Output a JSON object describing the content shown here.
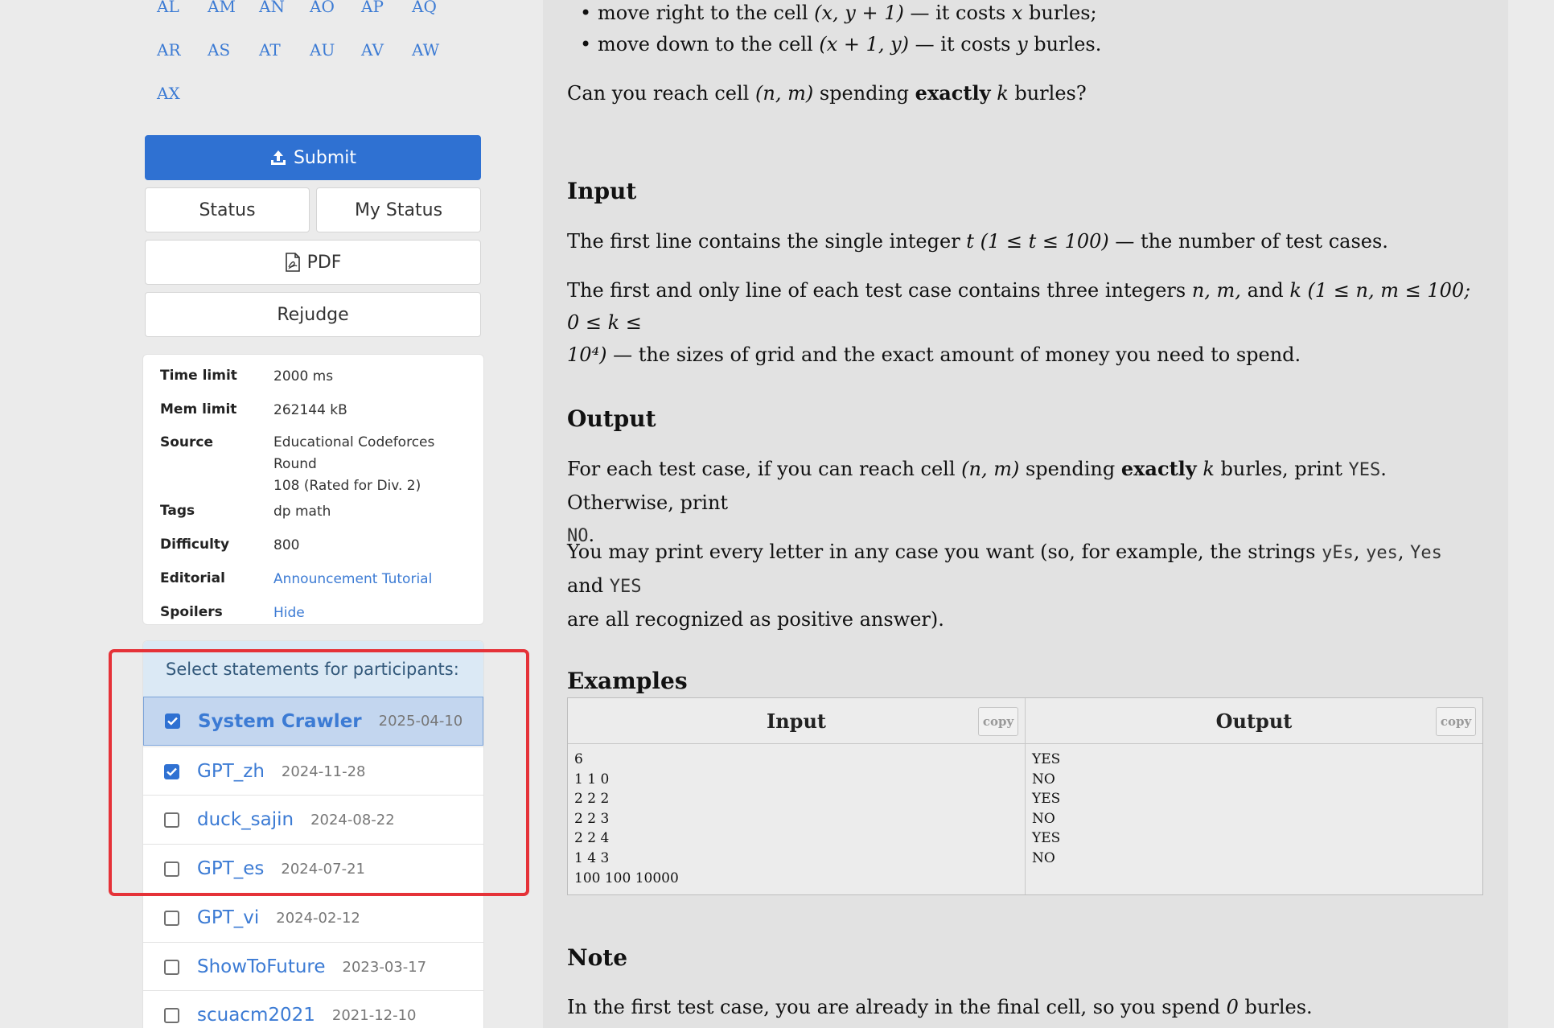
{
  "letters": [
    "AL",
    "AM",
    "AN",
    "AO",
    "AP",
    "AQ",
    "AR",
    "AS",
    "AT",
    "AU",
    "AV",
    "AW",
    "AX"
  ],
  "actions": {
    "submit": "Submit",
    "status": "Status",
    "my_status": "My Status",
    "pdf": "PDF",
    "rejudge": "Rejudge"
  },
  "info": {
    "time_limit_label": "Time limit",
    "time_limit": "2000 ms",
    "mem_limit_label": "Mem limit",
    "mem_limit": "262144 kB",
    "source_label": "Source",
    "source_line1": "Educational Codeforces Round",
    "source_line2": "108 (Rated for Div. 2)",
    "tags_label": "Tags",
    "tags": "dp math",
    "difficulty_label": "Difficulty",
    "difficulty": "800",
    "editorial_label": "Editorial",
    "editorial_announcement": "Announcement",
    "editorial_tutorial": "Tutorial",
    "spoilers_label": "Spoilers",
    "spoilers": "Hide"
  },
  "statements": {
    "header": "Select statements for participants:",
    "items": [
      {
        "name": "System Crawler",
        "date": "2025-04-10",
        "checked": true,
        "active": true
      },
      {
        "name": "GPT_zh",
        "date": "2024-11-28",
        "checked": true,
        "active": false
      },
      {
        "name": "duck_sajin",
        "date": "2024-08-22",
        "checked": false,
        "active": false
      },
      {
        "name": "GPT_es",
        "date": "2024-07-21",
        "checked": false,
        "active": false
      },
      {
        "name": "GPT_vi",
        "date": "2024-02-12",
        "checked": false,
        "active": false
      },
      {
        "name": "ShowToFuture",
        "date": "2023-03-17",
        "checked": false,
        "active": false
      },
      {
        "name": "scuacm2021",
        "date": "2021-12-10",
        "checked": false,
        "active": false
      }
    ]
  },
  "problem": {
    "bullet1_a": "move right to the cell ",
    "bullet1_math": "(x, y + 1)",
    "bullet1_b": " — it costs ",
    "bullet1_var": "x",
    "bullet1_c": " burles;",
    "bullet2_a": "move down to the cell ",
    "bullet2_math": "(x + 1, y)",
    "bullet2_b": " — it costs ",
    "bullet2_var": "y",
    "bullet2_c": " burles.",
    "question_a": "Can you reach cell ",
    "question_math": "(n, m)",
    "question_b": " spending ",
    "question_bold": "exactly",
    "question_var": " k",
    "question_c": " burles?",
    "input_title": "Input",
    "input_p1_a": "The first line contains the single integer ",
    "input_p1_math": "t (1 ≤ t ≤ 100)",
    "input_p1_b": " — the number of test cases.",
    "input_p2_a": "The first and only line of each test case contains three integers ",
    "input_p2_math1": "n, m,",
    "input_p2_b": " and ",
    "input_p2_math2": "k (1 ≤ n, m ≤ 100; 0 ≤ k ≤",
    "input_p2_math3": "10⁴)",
    "input_p2_c": " — the sizes of grid and the exact amount of money you need to spend.",
    "output_title": "Output",
    "output_p1_a": "For each test case, if you can reach cell ",
    "output_p1_math": "(n, m)",
    "output_p1_b": " spending ",
    "output_p1_bold": "exactly",
    "output_p1_var": " k",
    "output_p1_c": " burles, print ",
    "output_p1_yes": "YES",
    "output_p1_d": ". Otherwise, print",
    "output_p1_no": "NO",
    "output_p1_e": ".",
    "output_p2_a": "You may print every letter in any case you want (so, for example, the strings ",
    "output_p2_c1": "yEs",
    "output_p2_c2": "yes",
    "output_p2_c3": "Yes",
    "output_p2_and": " and ",
    "output_p2_c4": "YES",
    "output_p2_b": "are all recognized as positive answer).",
    "examples_title": "Examples",
    "example_input_header": "Input",
    "example_output_header": "Output",
    "copy_label": "copy",
    "example_input": "6\n1 1 0\n2 2 2\n2 2 3\n2 2 4\n1 4 3\n100 100 10000",
    "example_output": "YES\nNO\nYES\nNO\nYES\nNO",
    "note_title": "Note",
    "note_p1_a": "In the first test case, you are already in the final cell, so you spend ",
    "note_p1_num": "0",
    "note_p1_b": " burles."
  },
  "colors": {
    "link": "#3c7bd4",
    "primary": "#2f71d2",
    "highlight_box": "#e53238",
    "statements_header_bg": "#dbe9f5",
    "active_row_bg": "#c3d6ef"
  }
}
